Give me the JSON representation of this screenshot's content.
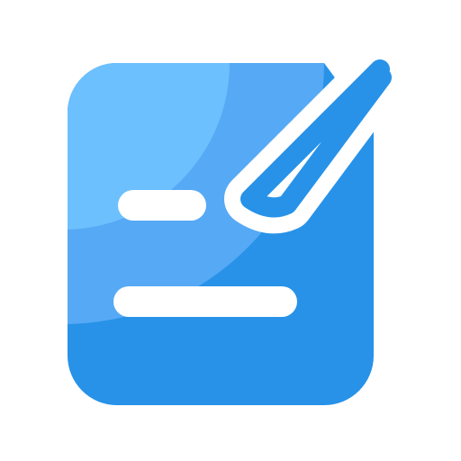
{
  "icon": {
    "name": "note-edit-icon",
    "colors": {
      "background": "#ffffff",
      "tile_dark": "#2792e8",
      "tile_mid": "#56a9f5",
      "tile_light": "#6cc0fd",
      "foreground": "#ffffff"
    }
  }
}
